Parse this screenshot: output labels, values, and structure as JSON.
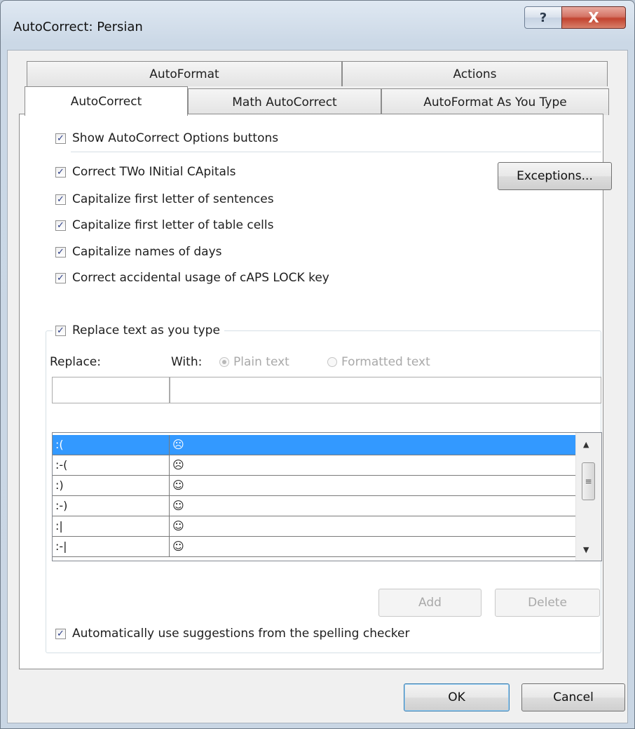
{
  "window": {
    "title": "AutoCorrect: Persian",
    "help_glyph": "?",
    "close_glyph": "X"
  },
  "tabs": {
    "back": [
      "AutoFormat",
      "Actions"
    ],
    "front": [
      "AutoCorrect",
      "Math AutoCorrect",
      "AutoFormat As You Type"
    ],
    "active": "AutoCorrect"
  },
  "options": {
    "show_buttons": "Show AutoCorrect Options buttons",
    "two_initials": "Correct TWo INitial CApitals",
    "sentences": "Capitalize first letter of sentences",
    "table_cells": "Capitalize first letter of table cells",
    "days": "Capitalize names of days",
    "caps_lock": "Correct accidental usage of cAPS LOCK key",
    "replace_text": "Replace text as you type",
    "suggestions": "Automatically use suggestions from the spelling checker"
  },
  "buttons": {
    "exceptions": "Exceptions...",
    "add": "Add",
    "delete": "Delete",
    "ok": "OK",
    "cancel": "Cancel"
  },
  "replace": {
    "replace_label": "Replace:",
    "with_label": "With:",
    "plain_text": "Plain text",
    "formatted_text": "Formatted text",
    "replace_value": "",
    "with_value": ""
  },
  "entries": [
    {
      "replace": ":(",
      "with": "☹",
      "selected": true
    },
    {
      "replace": ":-(",
      "with": "☹"
    },
    {
      "replace": ":)",
      "with": "☺"
    },
    {
      "replace": ":-)",
      "with": "☺"
    },
    {
      "replace": ":|",
      "with": "☺"
    },
    {
      "replace": ":-|",
      "with": "☺"
    }
  ],
  "icons": {
    "check": "✓",
    "scroll_up": "▲",
    "scroll_down": "▼",
    "thumb_grip": "≡"
  }
}
